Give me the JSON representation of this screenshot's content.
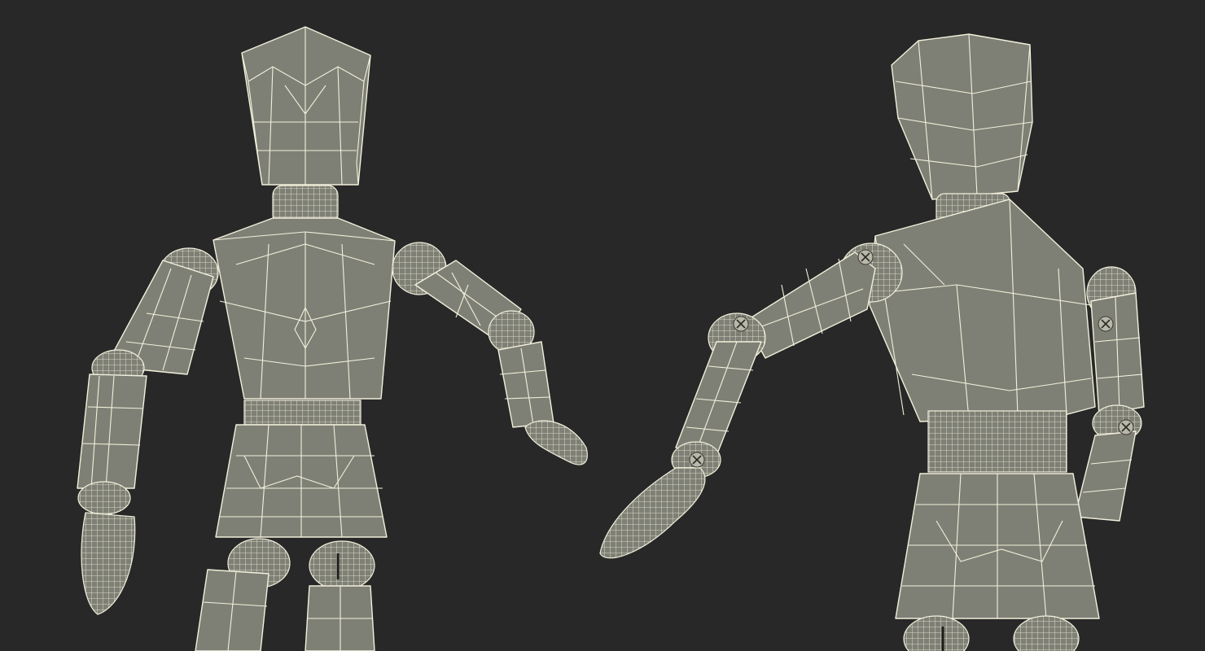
{
  "scene": {
    "background_color": "#282828",
    "mesh_fill_color": "#7f8075",
    "wireframe_color": "#f2f0dc"
  },
  "figures": [
    {
      "view": "front",
      "object": "wooden-mannequin-wireframe"
    },
    {
      "view": "back",
      "object": "wooden-mannequin-wireframe"
    }
  ]
}
